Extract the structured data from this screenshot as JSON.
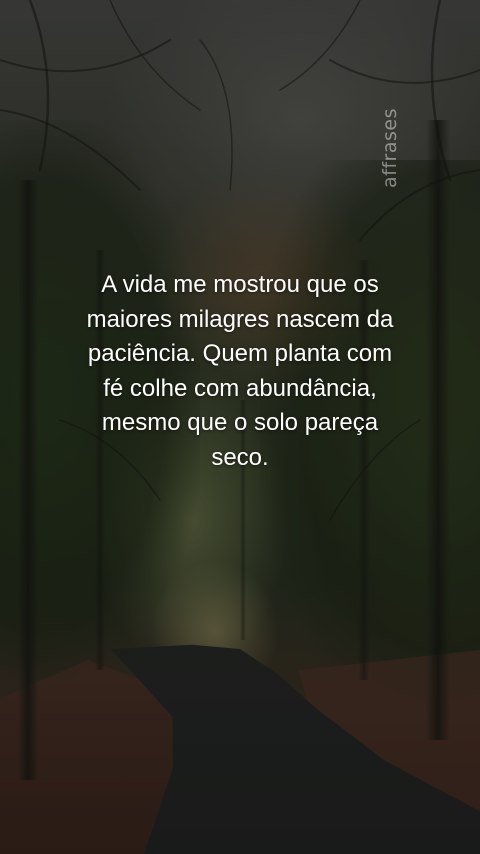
{
  "watermark": "affrases",
  "quote": {
    "lines": [
      "A vida me mostrou que os",
      "maiores milagres nascem da",
      "paciência. Quem planta com",
      "fé colhe com abundância,",
      "mesmo que o solo pareça",
      "seco."
    ]
  }
}
